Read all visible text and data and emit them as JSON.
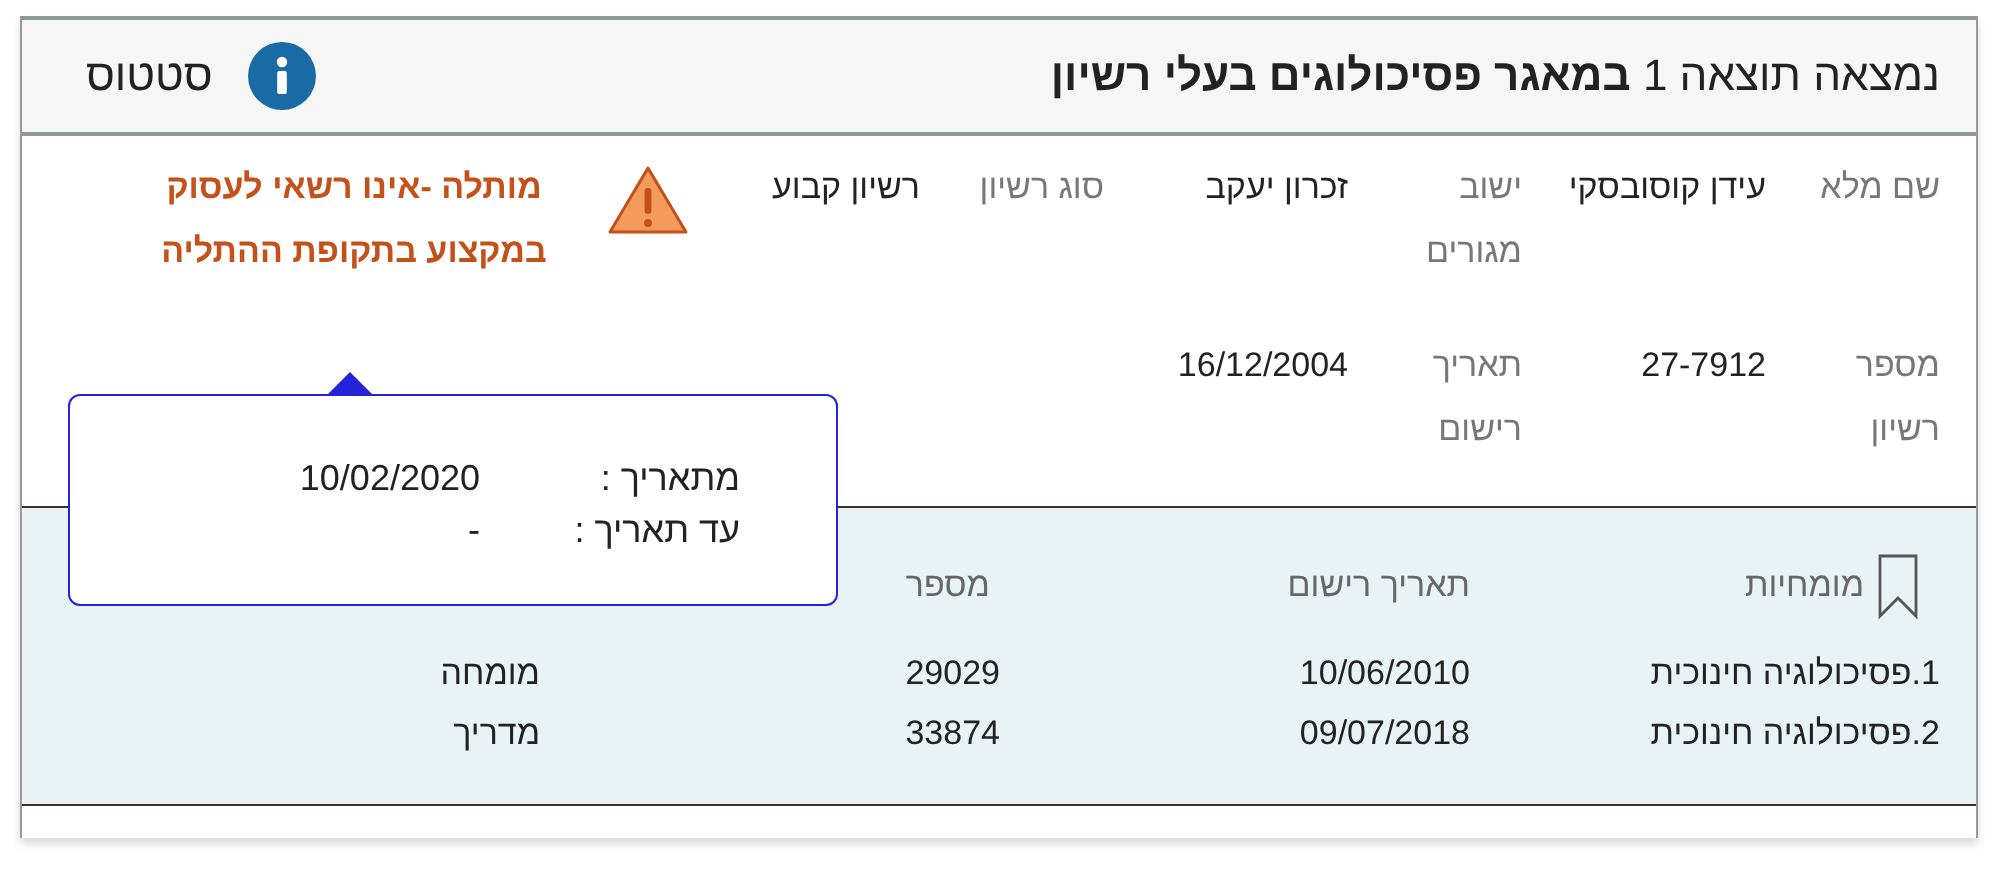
{
  "header": {
    "title": "נמצאה תוצאה 1 **במאגר פסיכולוגים בעלי רשיון**",
    "status_label": "סטטוס"
  },
  "details": [
    {
      "label": "שם מלא",
      "value": "עידן קוסובסקי"
    },
    {
      "label": "ישוב מגורים",
      "value": "זכרון יעקב"
    },
    {
      "label": "סוג רשיון",
      "value": "רשיון קבוע"
    },
    {
      "label": "מספר רשיון",
      "value": "27-7912"
    },
    {
      "label": "תאריך רישום",
      "value": "16/12/2004"
    }
  ],
  "license_status": {
    "kind": "suspended",
    "text": "מותלה -אינו רשאי לעסוק במקצוע בתקופת ההתליה"
  },
  "tooltip": {
    "rows": [
      {
        "label": "מתאריך :",
        "value": "10/02/2020"
      },
      {
        "label": "עד תאריך :",
        "value": "-"
      }
    ]
  },
  "specialties": {
    "columns": [
      "מומחיות",
      "תאריך רישום",
      "מספר"
    ],
    "rows": [
      [
        "1.פסיכולוגיה חינוכית",
        "10/06/2010",
        "29029",
        "מומחה"
      ],
      [
        "2.פסיכולוגיה חינוכית",
        "09/07/2018",
        "33874",
        "מדריך"
      ]
    ]
  }
}
